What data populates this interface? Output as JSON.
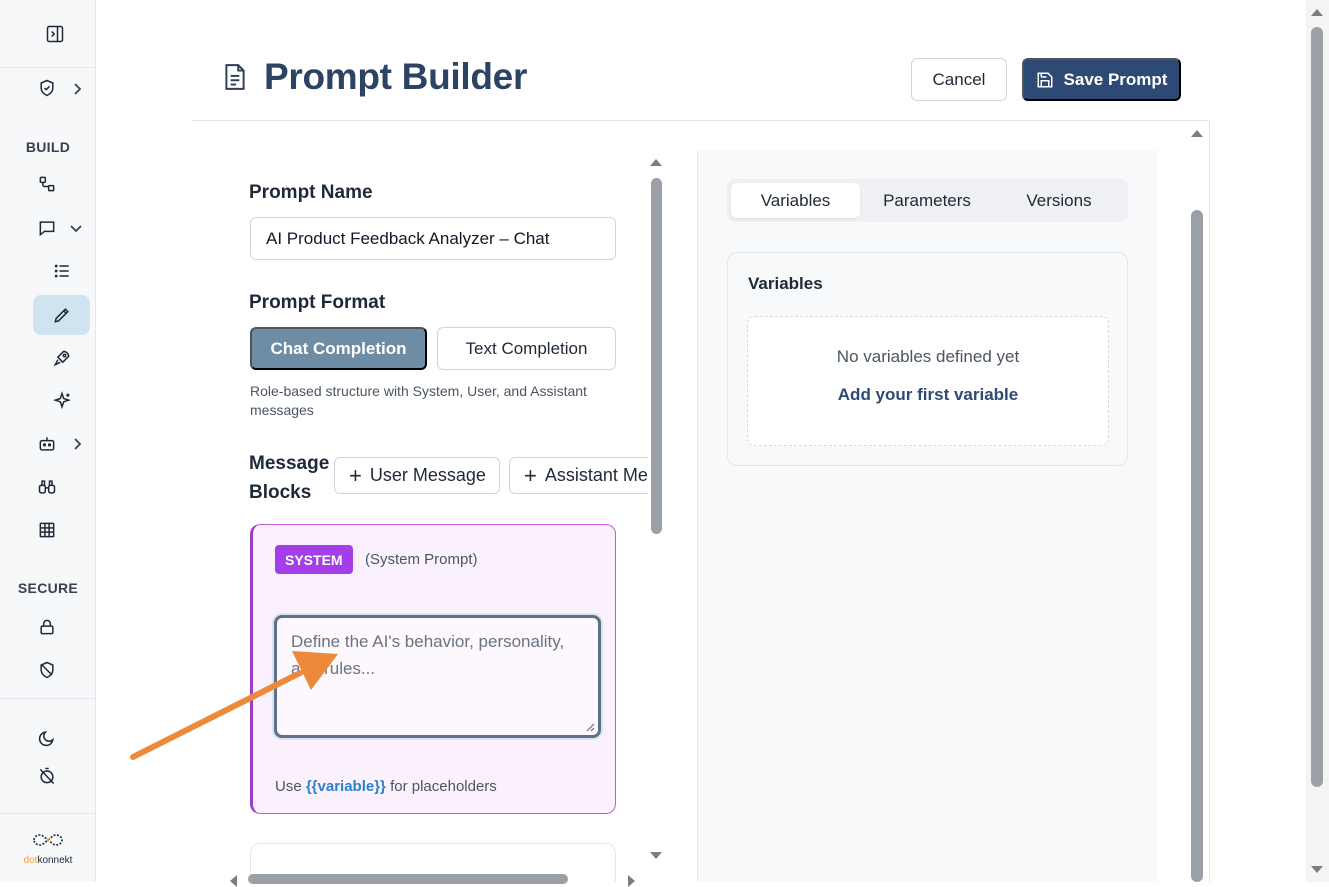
{
  "sidebar": {
    "section_build": "BUILD",
    "section_secure": "SECURE",
    "logo_text_accent": "dot",
    "logo_text_main": "konnekt"
  },
  "header": {
    "title": "Prompt Builder",
    "cancel_label": "Cancel",
    "save_label": "Save Prompt"
  },
  "form": {
    "name_label": "Prompt Name",
    "name_value": "AI Product Feedback Analyzer – Chat",
    "format_label": "Prompt Format",
    "format_options": [
      "Chat Completion",
      "Text Completion"
    ],
    "format_selected": "Chat Completion",
    "format_helper": "Role-based structure with System, User, and Assistant messages",
    "message_blocks_label_line1": "Message",
    "message_blocks_label_line2": "Blocks",
    "add_user_message": "User Message",
    "add_assistant_message": "Assistant Message"
  },
  "system_block": {
    "badge": "SYSTEM",
    "subtitle": "(System Prompt)",
    "placeholder": "Define the AI's behavior, personality, and rules...",
    "footer_prefix": "Use ",
    "footer_var": "{{variable}}",
    "footer_suffix": " for placeholders"
  },
  "right_panel": {
    "tabs": [
      "Variables",
      "Parameters",
      "Versions"
    ],
    "active_tab": "Variables",
    "variables_title": "Variables",
    "empty_message": "No variables defined yet",
    "add_link": "Add your first variable"
  },
  "colors": {
    "primary": "#2c4a73",
    "format_active": "#6f8ca5",
    "system_badge": "#a43ee8",
    "system_border": "#c45ad8",
    "annotation_arrow": "#ec8a3a"
  }
}
